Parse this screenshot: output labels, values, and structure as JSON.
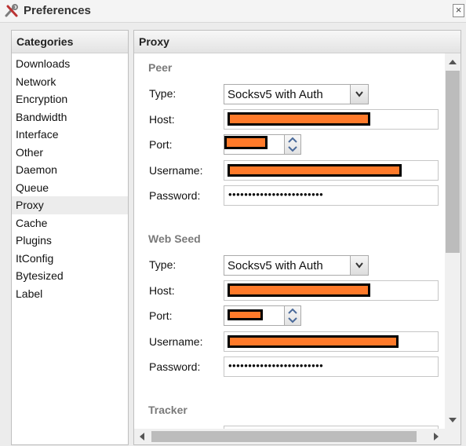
{
  "window": {
    "title": "Preferences",
    "close_label": "×"
  },
  "categories": {
    "header": "Categories",
    "items": [
      "Downloads",
      "Network",
      "Encryption",
      "Bandwidth",
      "Interface",
      "Other",
      "Daemon",
      "Queue",
      "Proxy",
      "Cache",
      "Plugins",
      "ItConfig",
      "Bytesized",
      "Label"
    ],
    "selected": "Proxy"
  },
  "proxy": {
    "header": "Proxy",
    "labels": {
      "type": "Type:",
      "host": "Host:",
      "port": "Port:",
      "username": "Username:",
      "password": "Password:"
    },
    "peer": {
      "title": "Peer",
      "type_value": "Socksv5 with Auth",
      "password_mask": "••••••••••••••••••••••••"
    },
    "web_seed": {
      "title": "Web Seed",
      "type_value": "Socksv5 with Auth",
      "password_mask": "••••••••••••••••••••••••"
    },
    "tracker": {
      "title": "Tracker"
    }
  },
  "colors": {
    "redaction": "#ff7a2a",
    "selected_row": "#ececec",
    "section_title": "#7a7a7a"
  },
  "icons": {
    "app": "tools-icon",
    "close": "close-icon",
    "dropdown": "chevron-down-icon",
    "spinner": "spinner-arrows-icon"
  }
}
